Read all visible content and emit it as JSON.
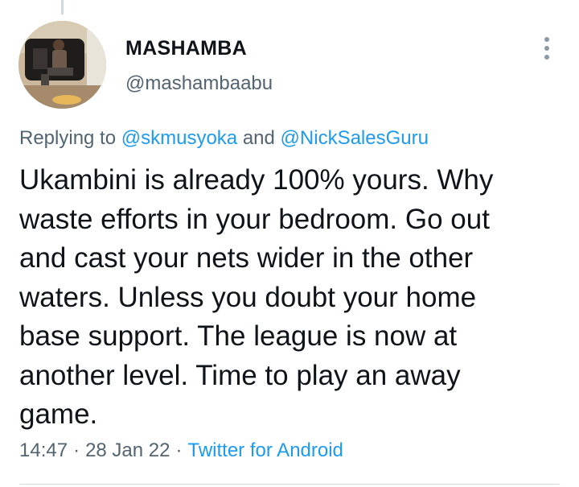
{
  "author": {
    "display_name": "MASHAMBA",
    "handle": "@mashambaabu"
  },
  "reply": {
    "prefix": "Replying to",
    "mentions": [
      "@skmusyoka",
      "@NickSalesGuru"
    ],
    "joiner": "and"
  },
  "tweet": {
    "lines": [
      "Ukambini is already 100% yours. Why",
      "waste efforts in your bedroom. Go out",
      "and cast your nets wider in the other",
      "waters. Unless you doubt your home",
      "base support. The league is now at",
      "another level. Time to play an away",
      "game."
    ]
  },
  "meta": {
    "time": "14:47",
    "separator": "·",
    "date": "28 Jan 22",
    "source": "Twitter for Android"
  },
  "icons": {
    "more": "more-vertical-icon"
  },
  "colors": {
    "link": "#1d9bf0",
    "secondary_text": "#536471",
    "primary_text": "#0f1419"
  }
}
